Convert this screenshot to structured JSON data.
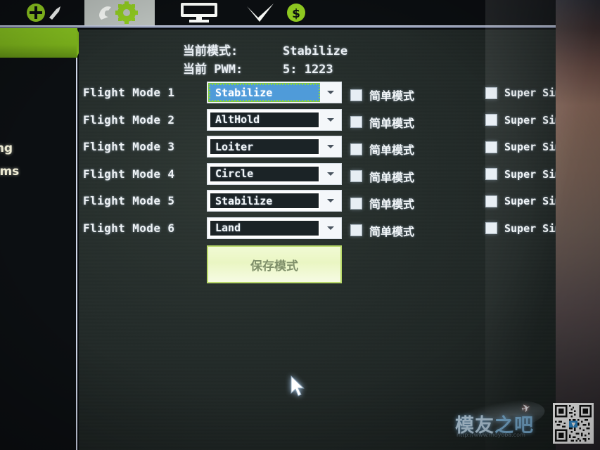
{
  "toolbar": {
    "items": [
      {
        "name": "initial-setup",
        "icon": "plus-wrench-icon",
        "active": false
      },
      {
        "name": "config-tuning",
        "icon": "wrench-gear-icon",
        "active": true
      },
      {
        "name": "simulation",
        "icon": "monitor-icon",
        "active": false
      },
      {
        "name": "terminal",
        "icon": "plane-check-icon",
        "active": false
      },
      {
        "name": "donate",
        "icon": "dollar-coin-icon",
        "active": false
      }
    ]
  },
  "sidebar": {
    "items": [
      {
        "label": "ing"
      },
      {
        "label": "ams"
      }
    ]
  },
  "status": {
    "current_mode_label": "当前模式:",
    "current_mode_value": "Stabilize",
    "current_pwm_label": "当前 PWM:",
    "current_pwm_value": "5: 1223"
  },
  "flight_modes": {
    "simple_label": "简单模式",
    "super_simple_label": "Super Simple",
    "rows": [
      {
        "label": "Flight Mode 1",
        "mode": "Stabilize",
        "focused": true,
        "simple": false,
        "super_simple": false
      },
      {
        "label": "Flight Mode 2",
        "mode": "AltHold",
        "focused": false,
        "simple": false,
        "super_simple": false
      },
      {
        "label": "Flight Mode 3",
        "mode": "Loiter",
        "focused": false,
        "simple": false,
        "super_simple": false
      },
      {
        "label": "Flight Mode 4",
        "mode": "Circle",
        "focused": false,
        "simple": false,
        "super_simple": false
      },
      {
        "label": "Flight Mode 5",
        "mode": "Stabilize",
        "focused": false,
        "simple": false,
        "super_simple": false
      },
      {
        "label": "Flight Mode 6",
        "mode": "Land",
        "focused": false,
        "simple": false,
        "super_simple": false
      }
    ]
  },
  "save_button": {
    "label": "保存模式"
  },
  "watermark": {
    "text_1": "模友",
    "text_2": "之吧",
    "url": "http://www.moyoba.com"
  },
  "colors": {
    "accent_green": "#7db41c",
    "selection_blue": "#4f9bd9",
    "focus_green": "#7cc63f",
    "save_button_bg": "#eaf6c3",
    "panel_bg": "#232b29"
  }
}
